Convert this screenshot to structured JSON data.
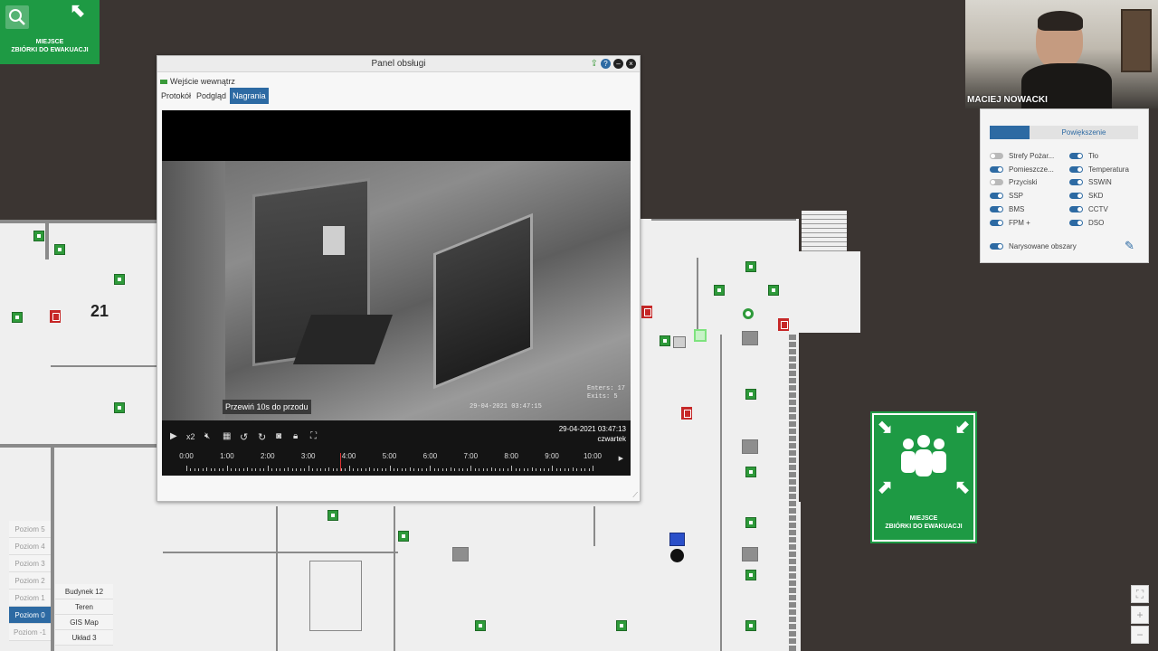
{
  "evac_sign": {
    "line1": "MIEJSCE",
    "line2": "ZBIÓRKI DO EWAKUACJI"
  },
  "map": {
    "room_number": "21"
  },
  "panel": {
    "title": "Panel obsługi",
    "camera_name": "Wejście wewnątrz",
    "tabs": [
      {
        "label": "Protokół"
      },
      {
        "label": "Podgląd"
      },
      {
        "label": "Nagrania"
      }
    ],
    "video": {
      "tooltip": "Przewiń 10s do przodu",
      "osd_timestamp": "29-04-2021 03:47:15",
      "osd_enters": "Enters: 17",
      "osd_exits": "Exits: 5",
      "date": "29-04-2021 03:47:13",
      "weekday": "czwartek",
      "speed": "x2",
      "timeline_labels": [
        "0:00",
        "1:00",
        "2:00",
        "3:00",
        "4:00",
        "5:00",
        "6:00",
        "7:00",
        "8:00",
        "9:00",
        "10:00"
      ]
    }
  },
  "webcam": {
    "name": "MACIEJ NOWACKI"
  },
  "layers": {
    "zoom_label": "Powiększenie",
    "left": [
      {
        "label": "Strefy Pożar...",
        "on": false
      },
      {
        "label": "Pomieszcze...",
        "on": true
      },
      {
        "label": "Przyciski",
        "on": false
      },
      {
        "label": "SSP",
        "on": true
      },
      {
        "label": "BMS",
        "on": true
      },
      {
        "label": "FPM +",
        "on": true
      }
    ],
    "right": [
      {
        "label": "Tło",
        "on": true
      },
      {
        "label": "Temperatura",
        "on": true
      },
      {
        "label": "SSWiN",
        "on": true
      },
      {
        "label": "SKD",
        "on": true
      },
      {
        "label": "CCTV",
        "on": true
      },
      {
        "label": "DSO",
        "on": true
      }
    ],
    "drawn_areas": {
      "label": "Narysowane obszary",
      "on": true
    }
  },
  "floors": [
    "Poziom 5",
    "Poziom 4",
    "Poziom 3",
    "Poziom 2",
    "Poziom 1",
    "Poziom 0",
    "Poziom -1"
  ],
  "active_floor": "Poziom 0",
  "buildings": [
    "Budynek 12",
    "Teren",
    "GIS Map",
    "Układ 3"
  ]
}
